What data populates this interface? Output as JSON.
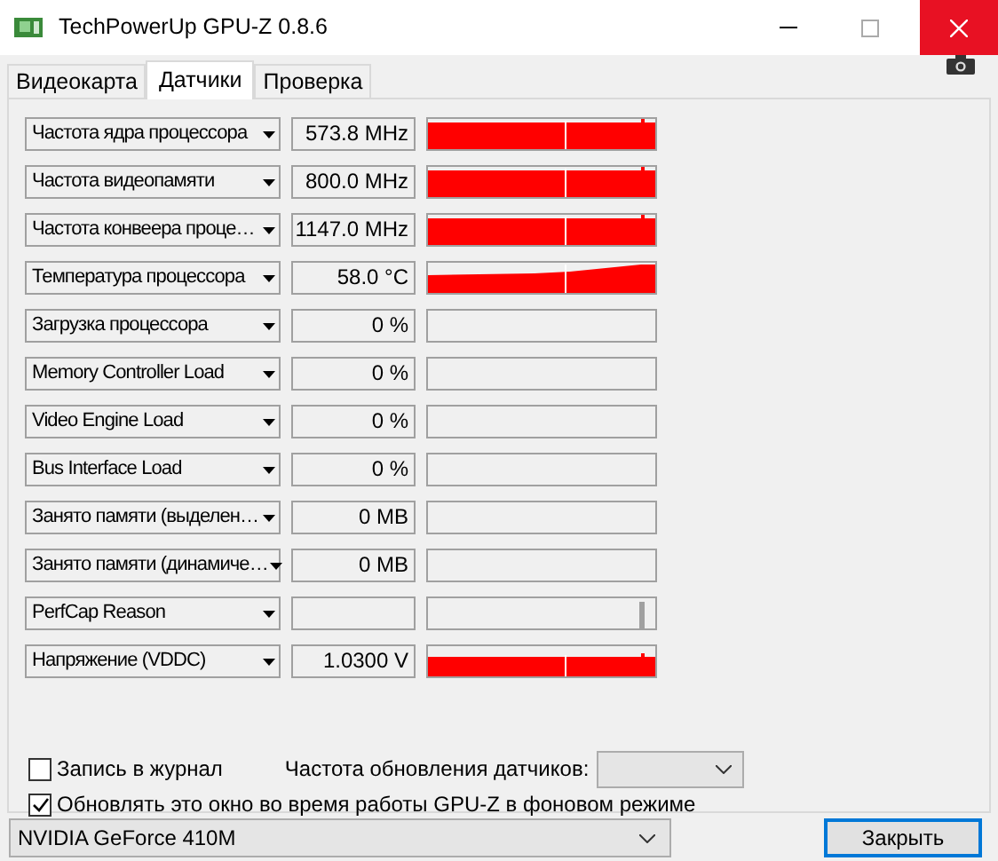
{
  "window": {
    "title": "TechPowerUp GPU-Z 0.8.6"
  },
  "tabs": [
    {
      "label": "Видеокарта",
      "selected": false
    },
    {
      "label": "Датчики",
      "selected": true
    },
    {
      "label": "Проверка",
      "selected": false
    }
  ],
  "sensors": [
    {
      "name": "Частота ядра процессора",
      "value": "573.8 MHz",
      "kind": "full"
    },
    {
      "name": "Частота видеопамяти",
      "value": "800.0 MHz",
      "kind": "full"
    },
    {
      "name": "Частота конвеера проце…",
      "value": "1147.0 MHz",
      "kind": "full"
    },
    {
      "name": "Температура процессора",
      "value": "58.0 °C",
      "kind": "rising"
    },
    {
      "name": "Загрузка процессора",
      "value": "0 %",
      "kind": "empty"
    },
    {
      "name": "Memory Controller Load",
      "value": "0 %",
      "kind": "empty"
    },
    {
      "name": "Video Engine Load",
      "value": "0 %",
      "kind": "empty"
    },
    {
      "name": "Bus Interface Load",
      "value": "0 %",
      "kind": "empty"
    },
    {
      "name": "Занято памяти (выделен…",
      "value": "0 MB",
      "kind": "empty"
    },
    {
      "name": "Занято памяти (динамиче…",
      "value": "0 MB",
      "kind": "empty"
    },
    {
      "name": "PerfCap Reason",
      "kind": "marker"
    },
    {
      "name": "Напряжение (VDDC)",
      "value": "1.0300 V",
      "kind": "low"
    }
  ],
  "log_to_file": {
    "label": "Запись в журнал",
    "checked": false
  },
  "refresh_rate": {
    "label": "Частота обновления датчиков:"
  },
  "background_refresh": {
    "label": "Обновлять это окно во время работы GPU-Z в фоновом режиме",
    "checked": true
  },
  "gpu_select": {
    "value": "NVIDIA GeForce 410M"
  },
  "close_button": {
    "label": "Закрыть"
  }
}
